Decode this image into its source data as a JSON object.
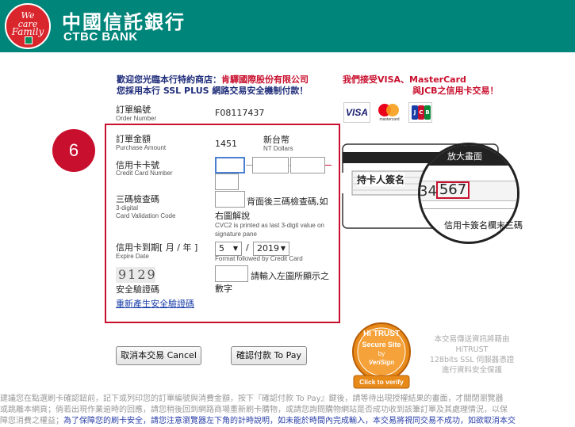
{
  "header": {
    "logo_text": [
      "We",
      "care",
      "Family"
    ],
    "bank_name_cn": "中國信託銀行",
    "bank_name_en": "CTBC BANK",
    "color": "#00857a"
  },
  "welcome": {
    "line1_prefix": "歡迎您光臨本行特約商店：",
    "merchant": "肯驛國際股份有限公司",
    "line2": "您採用本行 SSL PLUS 網路交易安全機制付款！"
  },
  "accept": {
    "line1": "我們接受VISA、MasterCard",
    "line2": "與JCB之信用卡交易！"
  },
  "card_logos": [
    "VISA",
    "mastercard",
    "JCB"
  ],
  "order": {
    "label": "訂單編號",
    "sub": "Order Number",
    "value": "F08117437"
  },
  "step_number": "6",
  "amount": {
    "label": "訂單金額",
    "sub": "Purchase Amount",
    "value": "1451",
    "currency": "新台幣",
    "currency_sub": "NT Dollars"
  },
  "card_number": {
    "label": "信用卡卡號",
    "sub": "Credit Card Number"
  },
  "cvv": {
    "label": "三碼檢查碼",
    "sub1": "3-digital",
    "sub2": "Card Validation Code",
    "hint": "背面後三碼檢查碼,如",
    "hint2": "右圖解說",
    "note1": "CVC2 is printed as last 3-digit value on",
    "note2": "signature pane"
  },
  "expiry": {
    "label": "信用卡到期[ 月 / 年 ]",
    "sub": "Expire Date",
    "month": "5",
    "year": "2019",
    "separator": "/",
    "note": "Format followed by Credit Card"
  },
  "captcha": {
    "image_text": "9129",
    "label": "安全驗證碼",
    "hint": "請輸入左圖所顯示之",
    "hint2": "數字",
    "regen_link": "重新產生安全驗證碼"
  },
  "buttons": {
    "cancel": "取消本交易 Cancel",
    "pay": "確認付款 To Pay"
  },
  "cvv_illustration": {
    "zoom_label": "放大畫面",
    "signature_label": "持卡人簽名",
    "digits_prefix": "34",
    "digits": "567",
    "caption": "信用卡簽名欄末三碼"
  },
  "hitrust_badge": {
    "line1": "Hi TRUST",
    "line2": "Secure Site",
    "line3": "by",
    "line4": "VeriSign",
    "line5": "Click to verify"
  },
  "hitrust_info": [
    "本交易傳送資訊將藉由",
    "HiTRUST",
    "128bits SSL 伺服器憑證",
    "進行資料安全保護"
  ],
  "bottom_text": {
    "line1": "建議您在點選刷卡確認鈕前，記下或列印您的訂單編號與消費金額，按下『確認付款 To Pay』鍵後，請等待出現授權結果的畫面，才關閉瀏覽器",
    "line2": "或跳離本網頁；倘若出現作業逾時的回應，請您稍後回到網路商場重新刷卡購物，或請您詢問購物網站是否成功收到該筆訂單及其處理情況，以保",
    "line3_prefix": "障您消費之權益；",
    "line3_highlight": "為了保障您的刷卡安全，請您注意瀏覽器左下角的計時說明，如未能於時間內完成輸入，本交易將視同交易不成功，如欲取消本交"
  }
}
